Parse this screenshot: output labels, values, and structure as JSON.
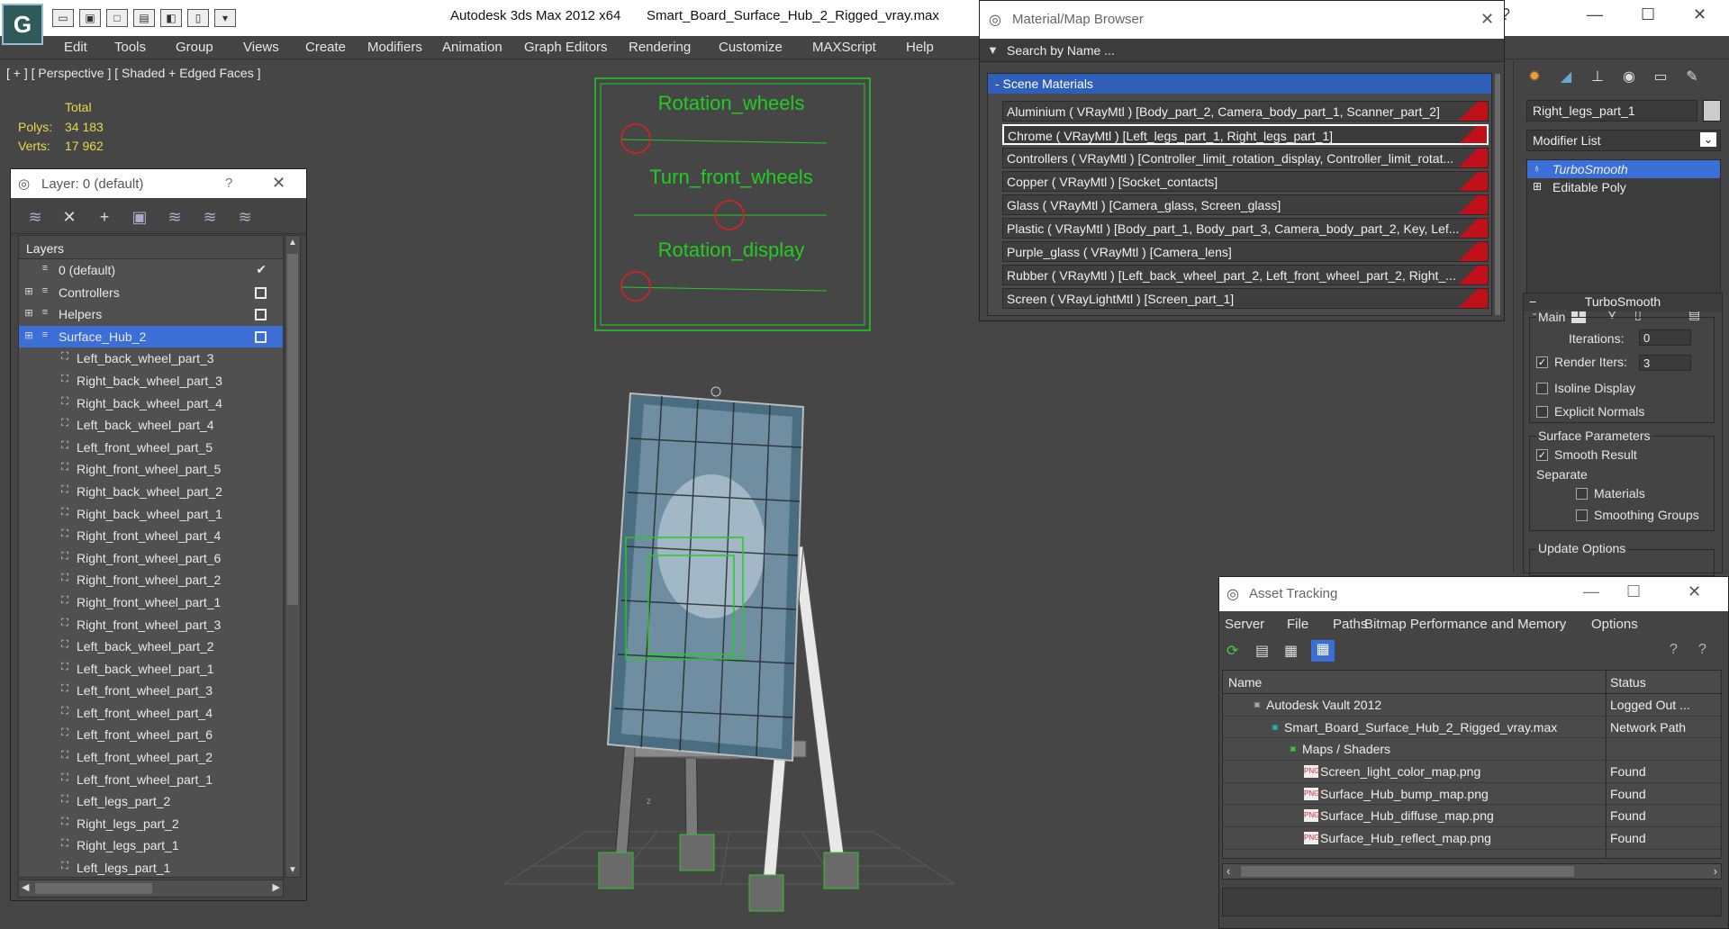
{
  "app": {
    "title": "Autodesk 3ds Max  2012 x64",
    "file": "Smart_Board_Surface_Hub_2_Rigged_vray.max"
  },
  "menu": [
    "Edit",
    "Tools",
    "Group",
    "Views",
    "Create",
    "Modifiers",
    "Animation",
    "Graph Editors",
    "Rendering",
    "Customize",
    "MAXScript",
    "Help"
  ],
  "viewport": {
    "label": "[ + ] [ Perspective ] [ Shaded + Edged Faces ]",
    "stats": {
      "total_label": "Total",
      "polys_label": "Polys:",
      "polys": "34 183",
      "verts_label": "Verts:",
      "verts": "17 962"
    },
    "controller_labels": [
      "Rotation_wheels",
      "Turn_front_wheels",
      "Rotation_display"
    ],
    "axis_label": "z"
  },
  "layer_panel": {
    "title": "Layer: 0 (default)",
    "help": "?",
    "list_header": "Layers",
    "layers": [
      {
        "name": "0 (default)",
        "type": "layer",
        "checked": true
      },
      {
        "name": "Controllers",
        "type": "layer"
      },
      {
        "name": "Helpers",
        "type": "layer"
      },
      {
        "name": "Surface_Hub_2",
        "type": "layer",
        "selected": true
      }
    ],
    "objects": [
      "Left_back_wheel_part_3",
      "Right_back_wheel_part_3",
      "Right_back_wheel_part_4",
      "Left_back_wheel_part_4",
      "Left_front_wheel_part_5",
      "Right_front_wheel_part_5",
      "Right_back_wheel_part_2",
      "Right_back_wheel_part_1",
      "Right_front_wheel_part_4",
      "Right_front_wheel_part_6",
      "Right_front_wheel_part_2",
      "Right_front_wheel_part_1",
      "Right_front_wheel_part_3",
      "Left_back_wheel_part_2",
      "Left_back_wheel_part_1",
      "Left_front_wheel_part_3",
      "Left_front_wheel_part_4",
      "Left_front_wheel_part_6",
      "Left_front_wheel_part_2",
      "Left_front_wheel_part_1",
      "Left_legs_part_2",
      "Right_legs_part_2",
      "Right_legs_part_1",
      "Left_legs_part_1"
    ]
  },
  "material_browser": {
    "title": "Material/Map Browser",
    "search_placeholder": "Search by Name ...",
    "section": "- Scene Materials",
    "materials": [
      "Aluminium  ( VRayMtl )  [Body_part_2, Camera_body_part_1, Scanner_part_2]",
      "Chrome  ( VRayMtl )  [Left_legs_part_1, Right_legs_part_1]",
      "Controllers  ( VRayMtl ) [Controller_limit_rotation_display, Controller_limit_rotat...",
      "Copper  ( VRayMtl )  [Socket_contacts]",
      "Glass  ( VRayMtl )  [Camera_glass, Screen_glass]",
      "Plastic  ( VRayMtl )  [Body_part_1, Body_part_3, Camera_body_part_2, Key, Lef...",
      "Purple_glass  ( VRayMtl )  [Camera_lens]",
      "Rubber  ( VRayMtl )  [Left_back_wheel_part_2, Left_front_wheel_part_2, Right_...",
      "Screen  ( VRayLightMtl )  [Screen_part_1]"
    ],
    "highlighted_index": 1
  },
  "command_panel": {
    "object_name": "Right_legs_part_1",
    "modifier_list": "Modifier List",
    "stack": [
      "TurboSmooth",
      "Editable Poly"
    ],
    "rollout_title": "TurboSmooth",
    "main_group": "Main",
    "iterations_label": "Iterations:",
    "iterations": "0",
    "render_iters_label": "Render Iters:",
    "render_iters": "3",
    "isoline": "Isoline Display",
    "explicit_normals": "Explicit Normals",
    "surface_params": "Surface Parameters",
    "smooth_result": "Smooth Result",
    "separate": "Separate",
    "materials": "Materials",
    "smoothing_groups": "Smoothing Groups",
    "update_options": "Update Options"
  },
  "asset_tracking": {
    "title": "Asset Tracking",
    "menu": [
      "Server",
      "File",
      "Paths",
      "Bitmap Performance and Memory",
      "Options"
    ],
    "col_name": "Name",
    "col_status": "Status",
    "rows": [
      {
        "name": "Autodesk Vault 2012",
        "status": "Logged Out ...",
        "indent": 0,
        "icon": "vault"
      },
      {
        "name": "Smart_Board_Surface_Hub_2_Rigged_vray.max",
        "status": "Network Path",
        "indent": 1,
        "icon": "max"
      },
      {
        "name": "Maps / Shaders",
        "status": "",
        "indent": 2,
        "icon": "folder"
      },
      {
        "name": "Screen_light_color_map.png",
        "status": "Found",
        "indent": 3,
        "icon": "png"
      },
      {
        "name": "Surface_Hub_bump_map.png",
        "status": "Found",
        "indent": 3,
        "icon": "png"
      },
      {
        "name": "Surface_Hub_diffuse_map.png",
        "status": "Found",
        "indent": 3,
        "icon": "png"
      },
      {
        "name": "Surface_Hub_reflect_map.png",
        "status": "Found",
        "indent": 3,
        "icon": "png"
      }
    ],
    "png_badge": "PNG"
  }
}
